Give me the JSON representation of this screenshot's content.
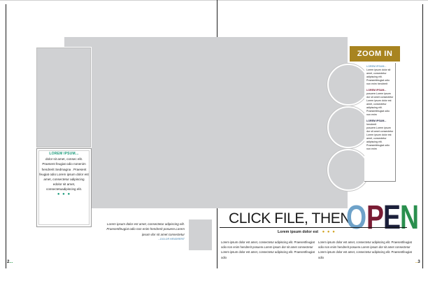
{
  "spread": {
    "left_card": {
      "title": "LOREM IPSUM...",
      "body": "dolor sit amet, consec elit. Praesent feugiat odio nonenim hendrerit Sedmagna . Praesent feugiat odio Lorem ipsum dolor est amet, consectetur adipiscing edolor sit amet, consectetuadipiscing elit.",
      "dots": "● ● ●"
    },
    "caption": {
      "text": "Lorem ipsum dolor est amet, consectetur adipiscing elit. Praesentfeugiat odio non enim hendrerit posuere.Lorem ipsum dor sit amet consectetur",
      "credit": "...DOLOR HENDRERIT"
    },
    "zoom_in": {
      "label": "ZOOM IN"
    },
    "sidebar": [
      {
        "heading": "LOREM IPSUM...",
        "body": "Lorem ipsum dolor sit amet, consectetur adipiscing elit. Praesentfeugiat odio non enim hendrerit"
      },
      {
        "heading": "LOREM IPSUM...",
        "body": "posuere.Lorem ipsum dor sit amet consectetur Lorem ipsum dolor est amet, consectetur adipiscing elit. Praesentfeugiat odio non enim"
      },
      {
        "heading": "LOREM IPSUM...",
        "body": "hendrerit posuere.Lorem ipsum dor sit amet consectetur Lorem ipsum dolor est amet, consectetur adipiscing elit. Praesentfeugiat odio non enim"
      }
    ],
    "headline": {
      "prefix": "CLICK FILE, THEN",
      "letters": [
        {
          "char": "O",
          "color": "#6ea2c9"
        },
        {
          "char": "P",
          "color": "#7a1c34"
        },
        {
          "char": "E",
          "color": "#1b1f3a"
        },
        {
          "char": "N",
          "color": "#2a8f4e"
        }
      ]
    },
    "subhead": {
      "text": "Lorem ipsum dolor est",
      "dots": "● ● ●"
    },
    "columns": [
      "Lorem ipsum dolor est amet, consectetur adipiscing elit. Praesentfeugiat odio non enim hendrerit posuere.Lorem ipsum dor sit amet consectetur Lorem ipsum dolor est amet, consectetur adipiscing elit. Praesentfeugiat odio",
      "Lorem ipsum dolor est amet, consectetur adipiscing elit. Praesentfeugiat odio non enim hendrerit posuere.Lorem ipsum dor sit amet consectetur Lorem ipsum dolor est amet, consectetur adipiscing elit. Praesentfeugiat odio"
    ],
    "folio_left": {
      "num": "2",
      "dots": "..."
    },
    "folio_right": {
      "num": "3",
      "dots": ".."
    },
    "colors": {
      "gold": "#a88420",
      "photo_placeholder": "#d0d1d3"
    }
  }
}
